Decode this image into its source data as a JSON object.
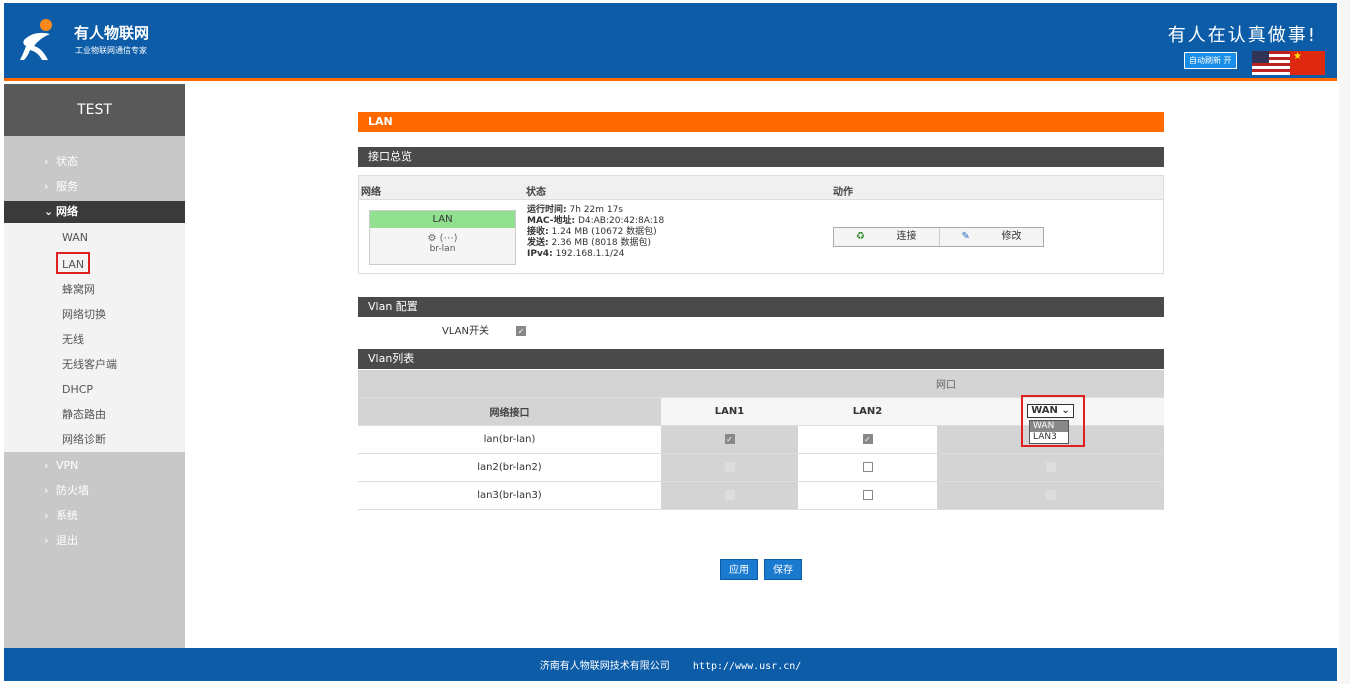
{
  "header": {
    "brand": "有人物联网",
    "brand_sub": "工业物联网通信专家",
    "slogan": "有人在认真做事!",
    "auto_refresh": "自动刷新 开",
    "brand_color": "#0c5ca8",
    "accent_color": "#ff6a00"
  },
  "sidebar": {
    "title": "TEST",
    "items": [
      {
        "label": "状态",
        "icon": "chevron-right-icon"
      },
      {
        "label": "服务",
        "icon": "chevron-right-icon"
      },
      {
        "label": "网络",
        "icon": "chevron-down-icon",
        "active": true
      },
      {
        "label": "VPN",
        "icon": "chevron-right-icon"
      },
      {
        "label": "防火墙",
        "icon": "chevron-right-icon"
      },
      {
        "label": "系统",
        "icon": "chevron-right-icon"
      },
      {
        "label": "退出",
        "icon": "chevron-right-icon"
      }
    ],
    "network_sub": [
      "WAN",
      "LAN",
      "蜂窝网",
      "网络切换",
      "无线",
      "无线客户端",
      "DHCP",
      "静态路由",
      "网络诊断"
    ]
  },
  "main": {
    "page_title": "LAN",
    "overview": {
      "title": "接口总览",
      "col_network": "网络",
      "col_status": "状态",
      "col_action": "动作",
      "iface_name": "LAN",
      "iface_icon_text": "(",
      "iface_icon_text2": ")",
      "iface_dev": "br-lan",
      "uptime_label": "运行时间:",
      "uptime_value": "7h 22m 17s",
      "mac_label": "MAC-地址:",
      "mac_value": "D4:AB:20:42:8A:18",
      "rx_label": "接收:",
      "rx_value": "1.24 MB (10672 数据包)",
      "tx_label": "发送:",
      "tx_value": "2.36 MB (8018 数据包)",
      "ipv4_label": "IPv4:",
      "ipv4_value": "192.168.1.1/24",
      "connect_label": "连接",
      "edit_label": "修改"
    },
    "vlan_config": {
      "title": "Vlan 配置",
      "switch_label": "VLAN开关",
      "switch_checked": true
    },
    "vlan_list": {
      "title": "Vlan列表",
      "group_header": "网口",
      "col_iface": "网络接口",
      "col_lan1": "LAN1",
      "col_lan2": "LAN2",
      "col_select_value": "WAN",
      "select_options": [
        "WAN",
        "LAN3"
      ],
      "rows": [
        {
          "name": "lan(br-lan)",
          "lan1": "checked",
          "lan2": "checked",
          "third": ""
        },
        {
          "name": "lan2(br-lan2)",
          "lan1": "disabled",
          "lan2": "unchecked",
          "third": "disabled"
        },
        {
          "name": "lan3(br-lan3)",
          "lan1": "disabled",
          "lan2": "unchecked",
          "third": "disabled"
        }
      ]
    },
    "apply_label": "应用",
    "save_label": "保存"
  },
  "footer": {
    "company": "济南有人物联网技术有限公司",
    "url": "http://www.usr.cn/"
  }
}
